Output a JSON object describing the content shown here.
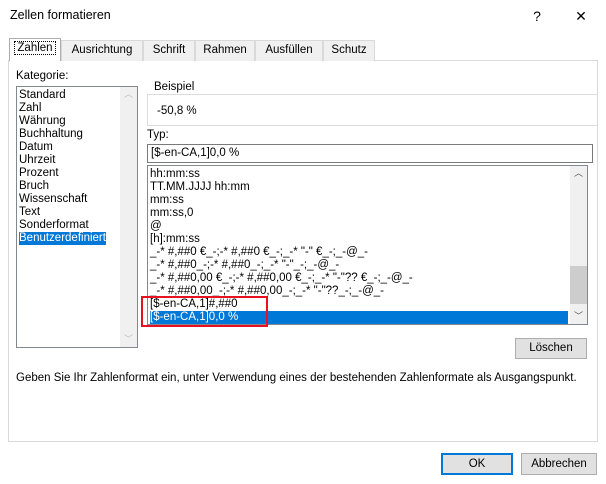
{
  "window": {
    "title": "Zellen formatieren",
    "help": "?",
    "close": "✕"
  },
  "tabs": [
    "Zahlen",
    "Ausrichtung",
    "Schrift",
    "Rahmen",
    "Ausfüllen",
    "Schutz"
  ],
  "category": {
    "label": "Kategorie:",
    "items": [
      "Standard",
      "Zahl",
      "Währung",
      "Buchhaltung",
      "Datum",
      "Uhrzeit",
      "Prozent",
      "Bruch",
      "Wissenschaft",
      "Text",
      "Sonderformat",
      "Benutzerdefiniert"
    ],
    "selected": "Benutzerdefiniert"
  },
  "sample": {
    "label": "Beispiel",
    "value": "-50,8 %"
  },
  "type": {
    "label": "Typ:",
    "value": "[$-en-CA,1]0,0 %"
  },
  "formats": {
    "items": [
      "hh:mm:ss",
      "TT.MM.JJJJ hh:mm",
      "mm:ss",
      "mm:ss,0",
      "@",
      "[h]:mm:ss",
      "_-* #,##0 €_-;-* #,##0 €_-;_-* \"-\" €_-;_-@_-",
      "_-* #,##0_-;-* #,##0_-;_-* \"-\"_-;_-@_-",
      "_-* #,##0,00 €_-;-* #,##0,00 €_-;_-* \"-\"?? €_-;_-@_-",
      "_-* #,##0,00_-;-* #,##0,00_-;_-* \"-\"??_-;_-@_-",
      "[$-en-CA,1]#,##0",
      "[$-en-CA,1]0,0 %"
    ],
    "selected": "[$-en-CA,1]0,0 %",
    "highlight_color": "#e81123"
  },
  "buttons": {
    "delete": "Löschen",
    "ok": "OK",
    "cancel": "Abbrechen"
  },
  "hint": "Geben Sie Ihr Zahlenformat ein, unter Verwendung eines der bestehenden Zahlenformate als Ausgangspunkt."
}
